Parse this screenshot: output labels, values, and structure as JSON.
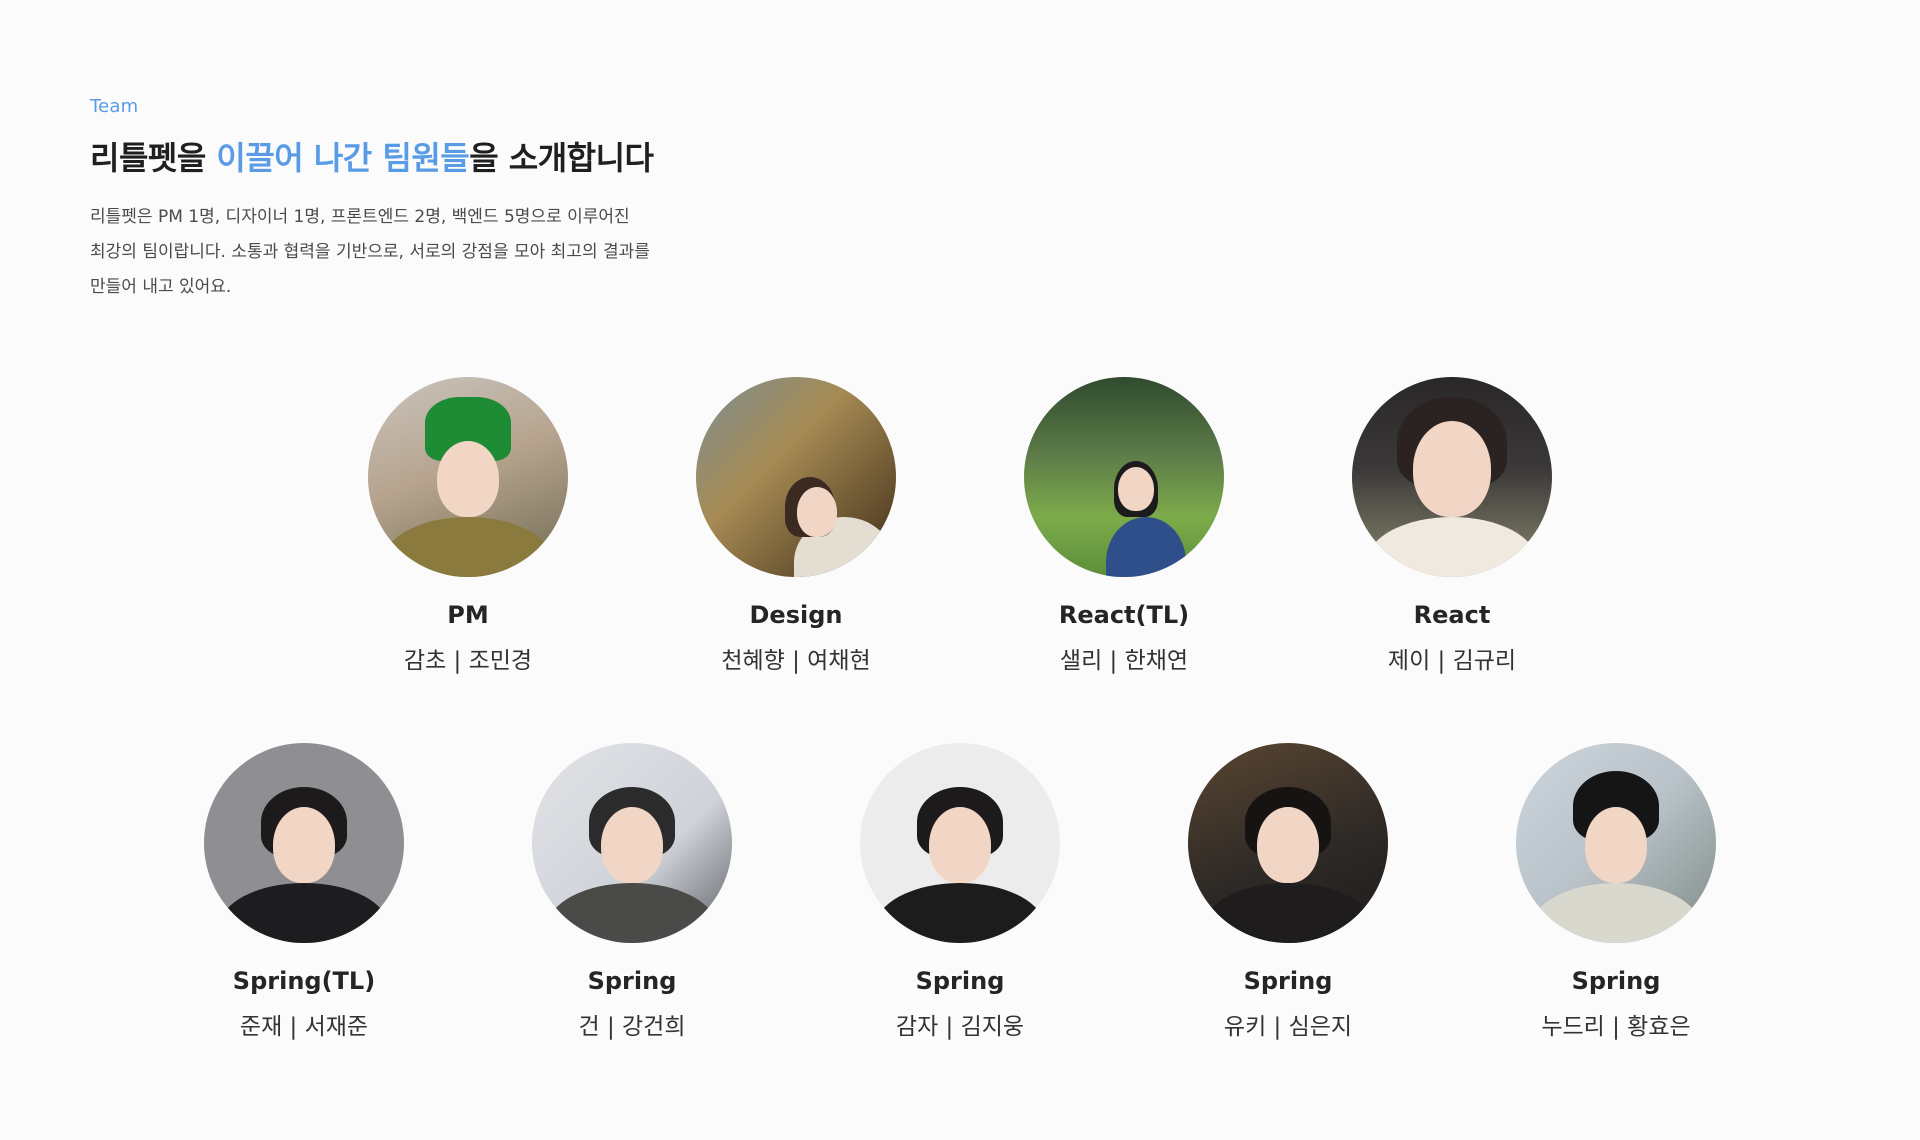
{
  "intro": {
    "eyebrow": "Team",
    "headline_pre": "리틀펫을 ",
    "headline_accent": "이끌어 나간 팀원들",
    "headline_post": "을 소개합니다",
    "description": "리틀펫은 PM 1명, 디자이너 1명, 프론트엔드 2명, 백엔드 5명으로 이루어진 최강의 팀이랍니다. 소통과 협력을 기반으로, 서로의 강점을 모아 최고의 결과를 만들어 내고 있어요."
  },
  "colors": {
    "accent": "#5a9be6",
    "text": "#1f1f1f"
  },
  "team": {
    "row1": [
      {
        "role": "PM",
        "name": "감초 | 조민경"
      },
      {
        "role": "Design",
        "name": "천혜향 | 여채현"
      },
      {
        "role": "React(TL)",
        "name": "샐리 | 한채연"
      },
      {
        "role": "React",
        "name": "제이 | 김규리"
      }
    ],
    "row2": [
      {
        "role": "Spring(TL)",
        "name": "준재 | 서재준"
      },
      {
        "role": "Spring",
        "name": "건 | 강건희"
      },
      {
        "role": "Spring",
        "name": "감자 | 김지웅"
      },
      {
        "role": "Spring",
        "name": "유키 | 심은지"
      },
      {
        "role": "Spring",
        "name": "누드리 | 황효은"
      }
    ]
  }
}
